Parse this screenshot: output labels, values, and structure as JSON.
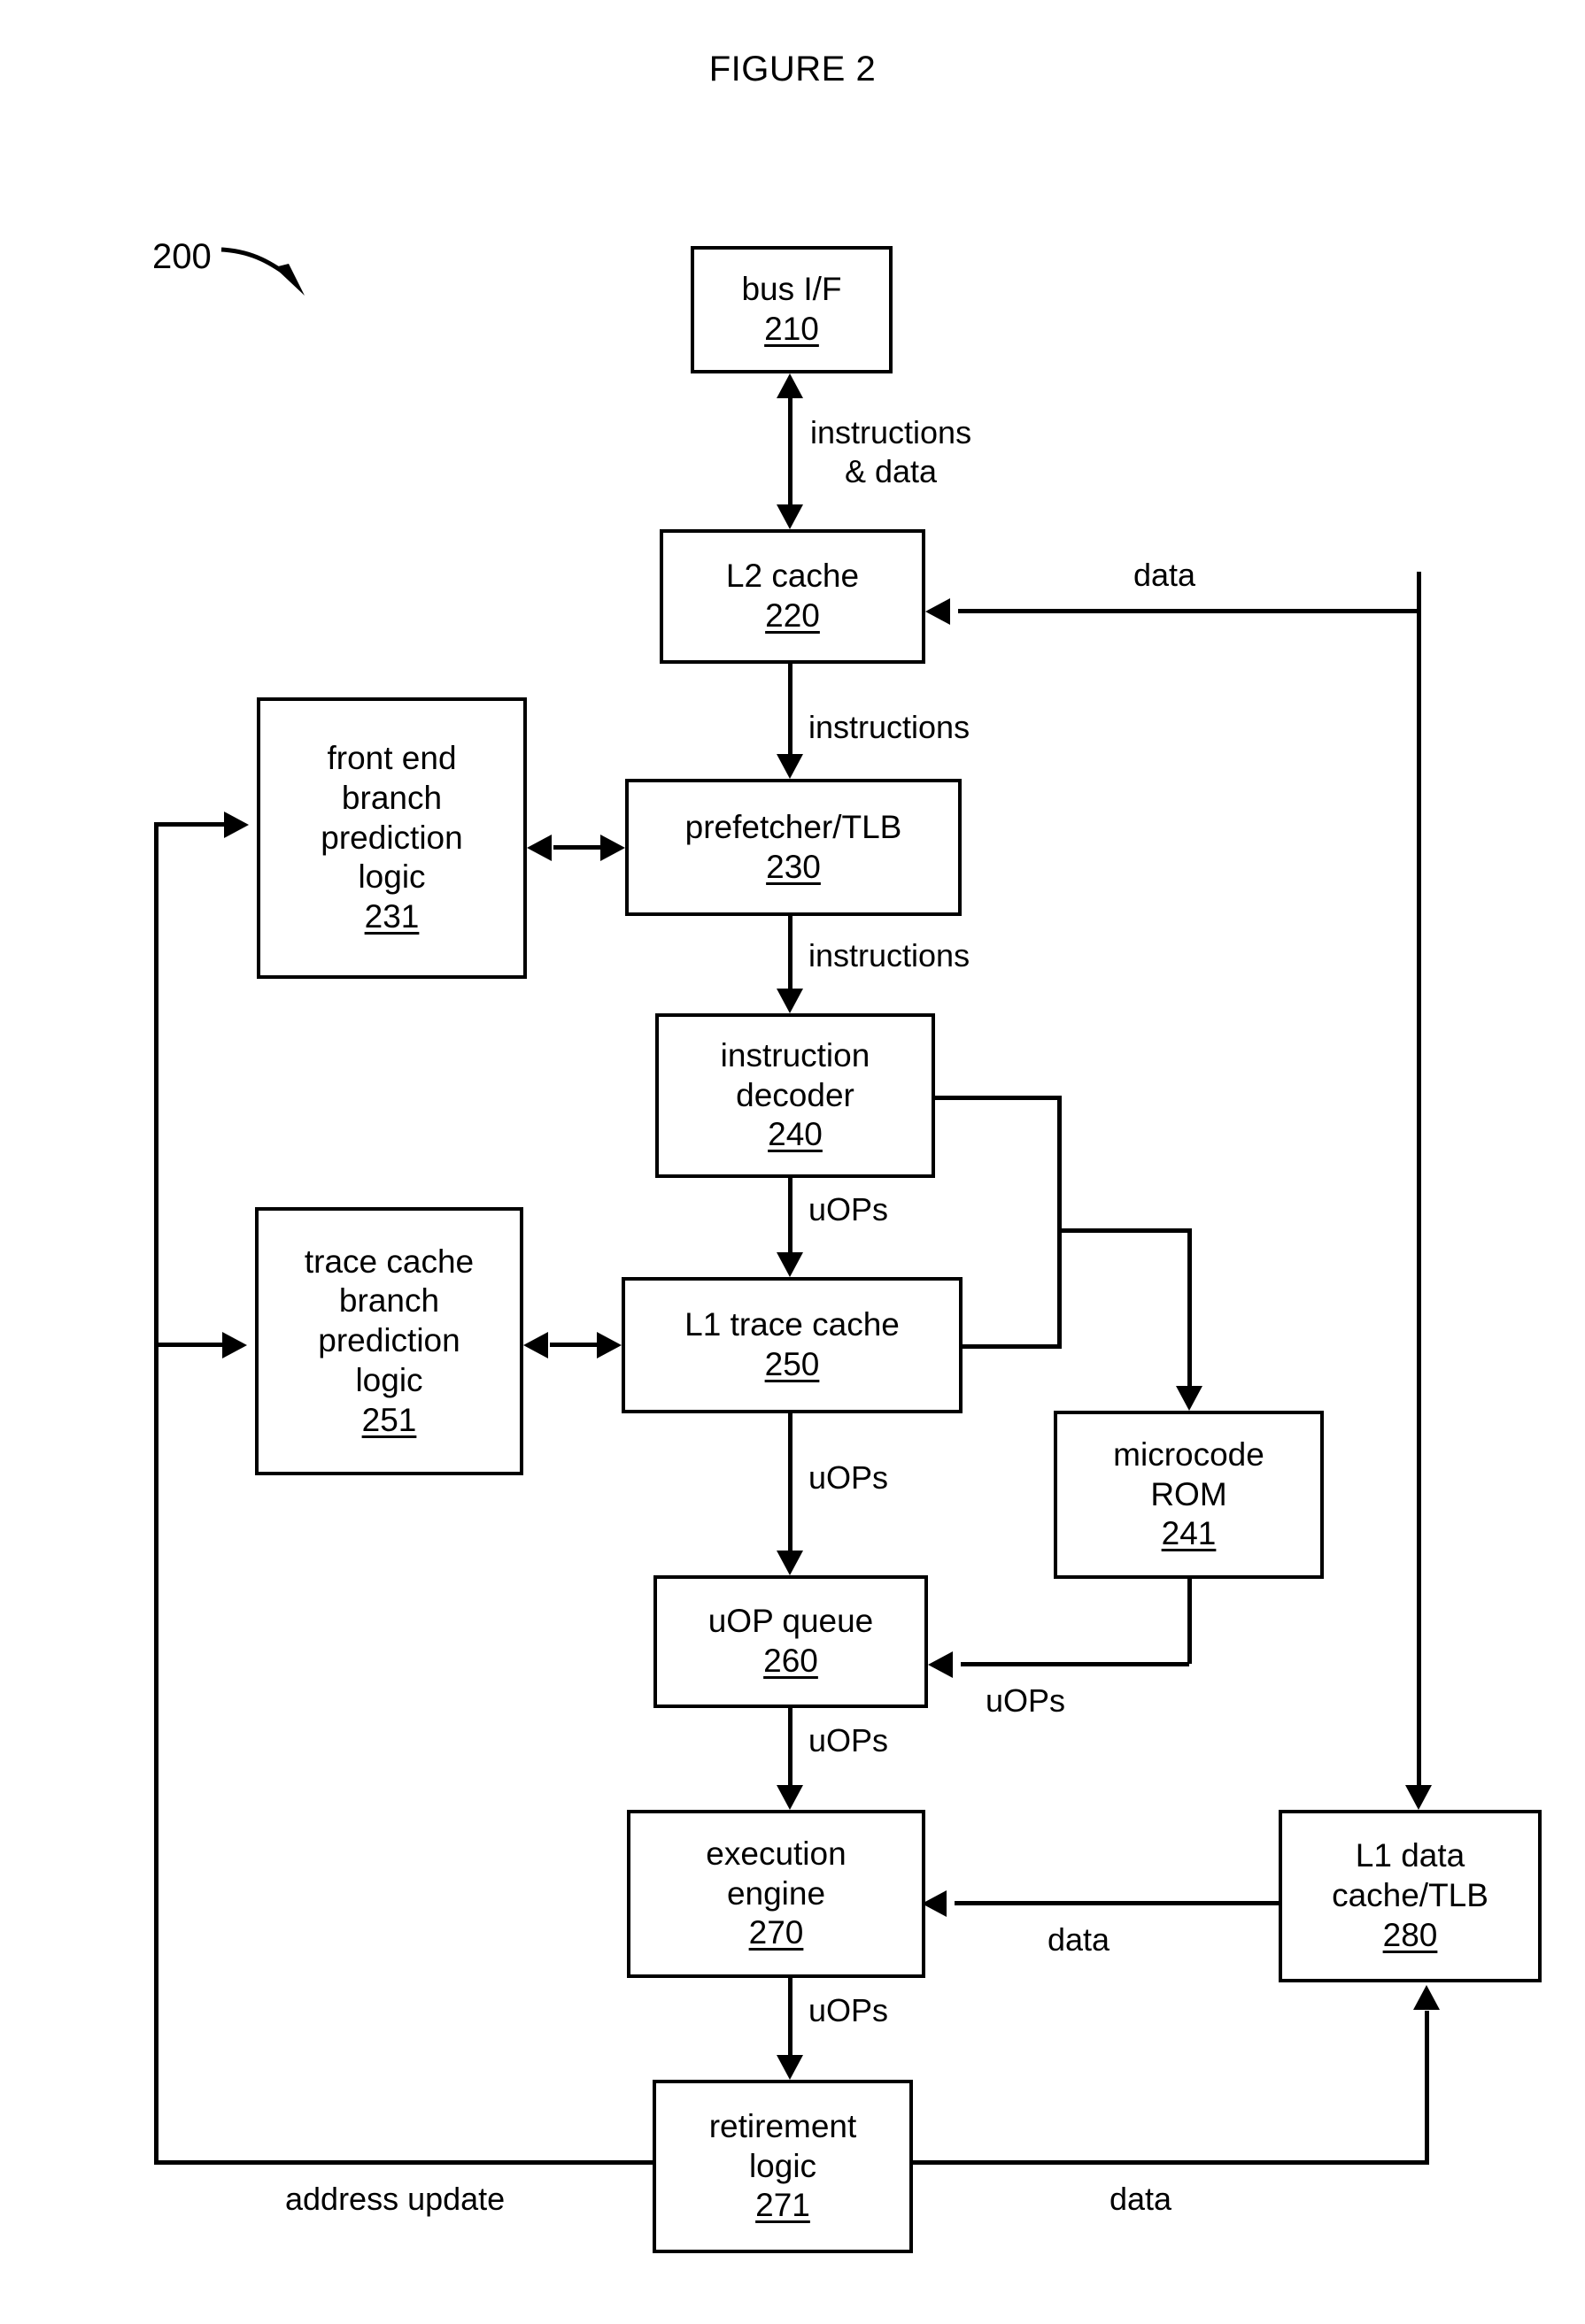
{
  "figure": {
    "title": "FIGURE 2",
    "reference_numeral": "200"
  },
  "blocks": [
    {
      "id": "bus_if",
      "lines": [
        "bus I/F"
      ],
      "ref": "210"
    },
    {
      "id": "l2_cache",
      "lines": [
        "L2 cache"
      ],
      "ref": "220"
    },
    {
      "id": "fe_bp_logic",
      "lines": [
        "front end",
        "branch",
        "prediction",
        "logic"
      ],
      "ref": "231"
    },
    {
      "id": "prefetcher",
      "lines": [
        "prefetcher/TLB"
      ],
      "ref": "230"
    },
    {
      "id": "decoder",
      "lines": [
        "instruction",
        "decoder"
      ],
      "ref": "240"
    },
    {
      "id": "tc_bp_logic",
      "lines": [
        "trace cache",
        "branch",
        "prediction",
        "logic"
      ],
      "ref": "251"
    },
    {
      "id": "l1_trace",
      "lines": [
        "L1 trace cache"
      ],
      "ref": "250"
    },
    {
      "id": "microcode_rom",
      "lines": [
        "microcode",
        "ROM"
      ],
      "ref": "241"
    },
    {
      "id": "uop_queue",
      "lines": [
        "uOP queue"
      ],
      "ref": "260"
    },
    {
      "id": "exec_engine",
      "lines": [
        "execution",
        "engine"
      ],
      "ref": "270"
    },
    {
      "id": "l1_data",
      "lines": [
        "L1 data",
        "cache/TLB"
      ],
      "ref": "280"
    },
    {
      "id": "retirement",
      "lines": [
        "retirement",
        "logic"
      ],
      "ref": "271"
    }
  ],
  "edge_labels": {
    "bus_to_l2_line1": "instructions",
    "bus_to_l2_line2": "& data",
    "l2_data_in": "data",
    "l2_to_prefetcher": "instructions",
    "prefetcher_to_decoder": "instructions",
    "decoder_to_trace": "uOPs",
    "trace_to_queue": "uOPs",
    "rom_to_queue": "uOPs",
    "queue_to_exec": "uOPs",
    "l1data_to_exec": "data",
    "exec_to_retirement": "uOPs",
    "retirement_address_update": "address update",
    "retirement_data": "data"
  }
}
